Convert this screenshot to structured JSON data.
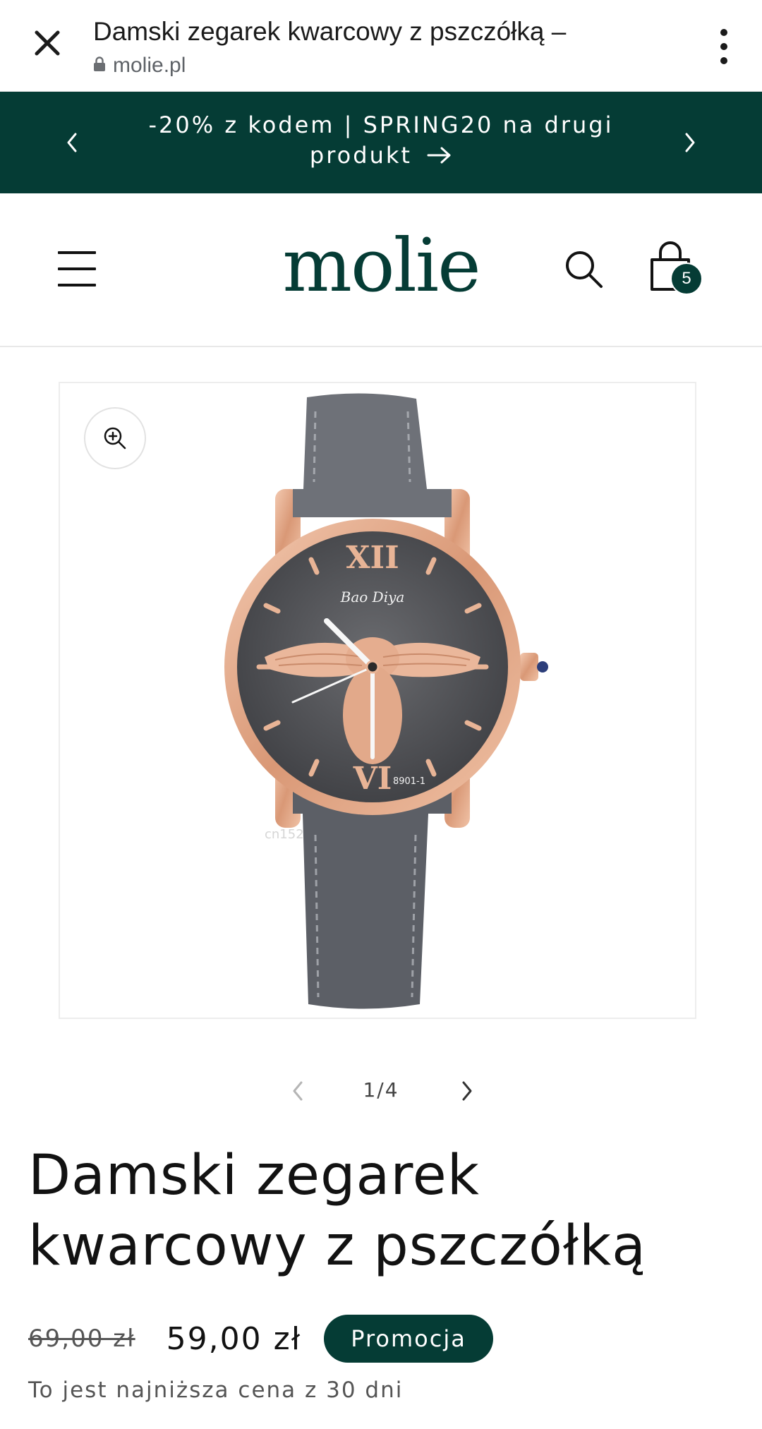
{
  "browser": {
    "title": "Damski zegarek kwarcowy z pszczółką –",
    "domain": "molie.pl",
    "close_icon": "close-icon",
    "menu_icon": "more-vertical-icon",
    "lock_icon": "lock-icon"
  },
  "announcement": {
    "line1": "-20% z kodem | SPRING20 na drugi",
    "line2": "produkt",
    "prev_icon": "chevron-left-icon",
    "next_icon": "chevron-right-icon",
    "arrow_icon": "arrow-right-icon"
  },
  "header": {
    "logo": "molie",
    "cart_count": "5",
    "menu_icon": "hamburger-icon",
    "search_icon": "search-icon",
    "cart_icon": "bag-icon"
  },
  "gallery": {
    "counter": "1/4",
    "zoom_icon": "zoom-in-icon",
    "image_watermark": "cn152",
    "watch_brand": "Bao Diya",
    "watch_model": "8901-1"
  },
  "product": {
    "title_line1": "Damski zegarek",
    "title_line2": "kwarcowy z pszczółką",
    "price_old": "69,00 zł",
    "price_new": "59,00 zł",
    "badge": "Promocja",
    "lowest_price_note": "To jest najniższa cena z 30 dni"
  },
  "colors": {
    "brand_green": "#053c35",
    "text": "#121212",
    "strap_grey": "#5c5f66",
    "rose_gold": "#e3a98a"
  }
}
